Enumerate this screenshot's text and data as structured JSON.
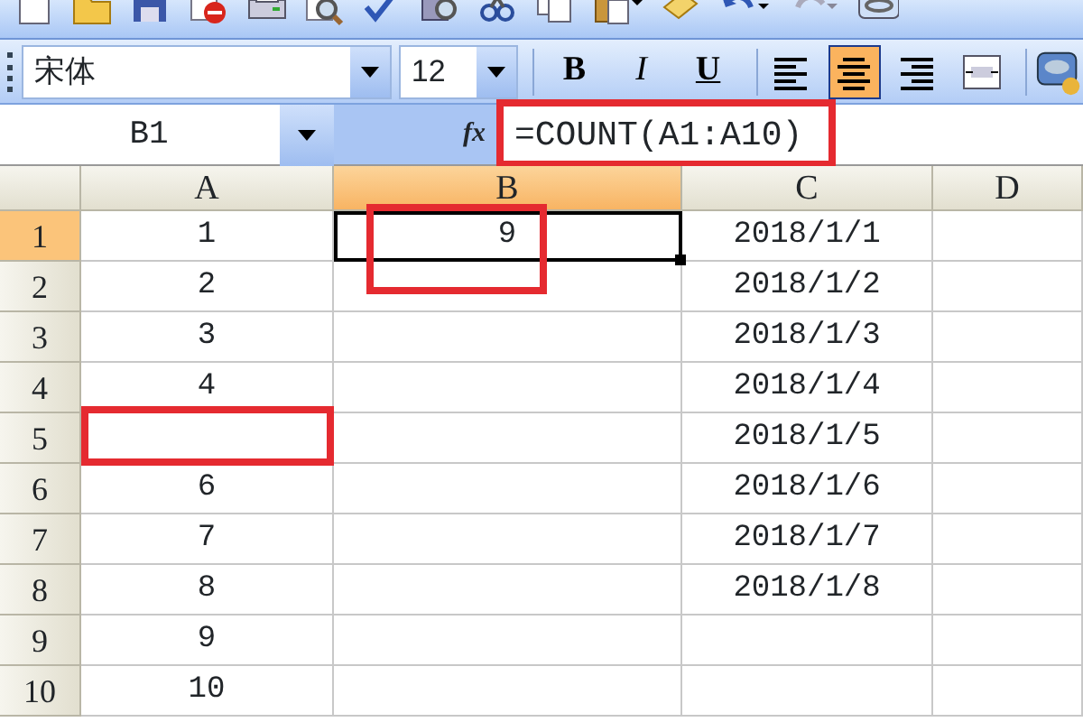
{
  "formatting_toolbar": {
    "font": "宋体",
    "size": "12",
    "style_buttons": [
      {
        "label": "B",
        "kind": "bold",
        "selected": false
      },
      {
        "label": "I",
        "kind": "italic",
        "selected": false
      },
      {
        "label": "U",
        "kind": "underline",
        "selected": false
      }
    ],
    "align_buttons": [
      {
        "kind": "left",
        "selected": false
      },
      {
        "kind": "center",
        "selected": true
      },
      {
        "kind": "right",
        "selected": false
      },
      {
        "kind": "merge",
        "selected": false
      }
    ]
  },
  "name_box": "B1",
  "formula_bar": {
    "function_label": "fx",
    "formula": "=COUNT(A1:A10)",
    "highlighted": true
  },
  "columns": [
    {
      "label": "A",
      "selected": false
    },
    {
      "label": "B",
      "selected": true
    },
    {
      "label": "C",
      "selected": false
    },
    {
      "label": "D",
      "selected": false
    }
  ],
  "rows": [
    {
      "header": "1",
      "selected": true,
      "cells": [
        {
          "value": "1"
        },
        {
          "value": "9",
          "active": true,
          "highlighted": true
        },
        {
          "value": "2018/1/1"
        },
        {}
      ]
    },
    {
      "header": "2",
      "selected": false,
      "cells": [
        {
          "value": "2"
        },
        {},
        {
          "value": "2018/1/2"
        },
        {}
      ]
    },
    {
      "header": "3",
      "selected": false,
      "cells": [
        {
          "value": "3"
        },
        {},
        {
          "value": "2018/1/3"
        },
        {}
      ]
    },
    {
      "header": "4",
      "selected": false,
      "cells": [
        {
          "value": "4"
        },
        {},
        {
          "value": "2018/1/4"
        },
        {}
      ]
    },
    {
      "header": "5",
      "selected": false,
      "cells": [
        {
          "highlighted": true
        },
        {},
        {
          "value": "2018/1/5"
        },
        {}
      ]
    },
    {
      "header": "6",
      "selected": false,
      "cells": [
        {
          "value": "6"
        },
        {},
        {
          "value": "2018/1/6"
        },
        {}
      ]
    },
    {
      "header": "7",
      "selected": false,
      "cells": [
        {
          "value": "7"
        },
        {},
        {
          "value": "2018/1/7"
        },
        {}
      ]
    },
    {
      "header": "8",
      "selected": false,
      "cells": [
        {
          "value": "8"
        },
        {},
        {
          "value": "2018/1/8"
        },
        {}
      ]
    },
    {
      "header": "9",
      "selected": false,
      "cells": [
        {
          "value": "9"
        },
        {},
        {},
        {}
      ]
    },
    {
      "header": "10",
      "selected": false,
      "cells": [
        {
          "value": "10"
        },
        {},
        {},
        {}
      ]
    }
  ]
}
